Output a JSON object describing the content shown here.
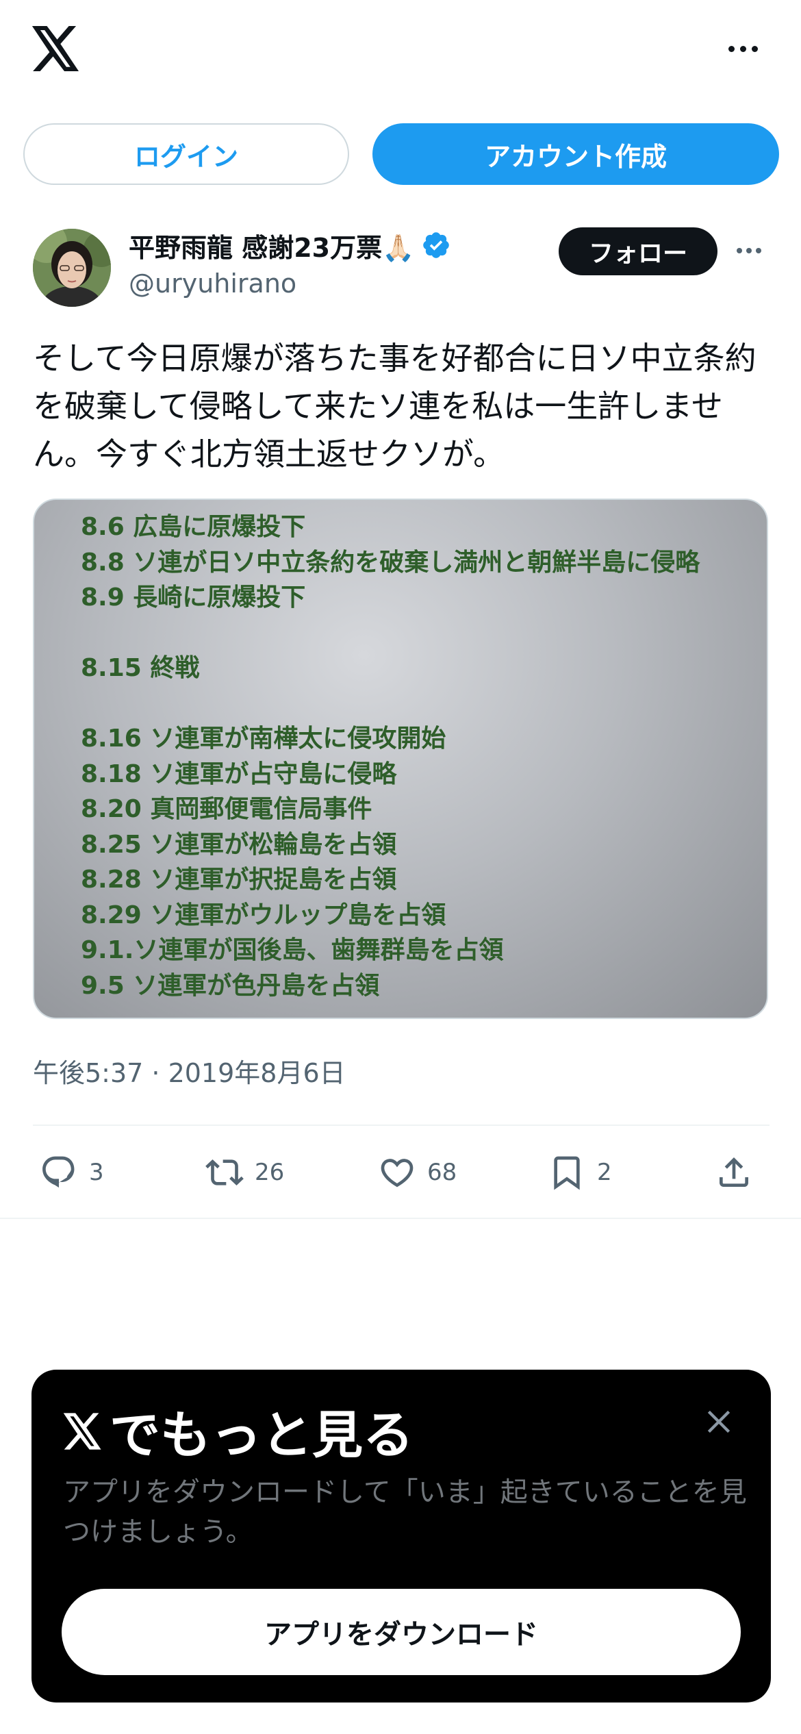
{
  "header": {
    "logo_icon": "x-logo-icon",
    "more_icon": "more-horizontal-icon"
  },
  "auth": {
    "login_label": "ログイン",
    "signup_label": "アカウント作成"
  },
  "post": {
    "author": {
      "display_name": "平野雨龍 感謝23万票🙏🏻",
      "handle": "@uryuhirano",
      "verified": true
    },
    "follow_label": "フォロー",
    "text": "そして今日原爆が落ちた事を好都合に日ソ中立条約を破棄して侵略して来たソ連を私は一生許しません。今すぐ北方領土返せクソが。",
    "image_lines": [
      "8.6 広島に原爆投下",
      "8.8 ソ連が日ソ中立条約を破棄し満州と朝鮮半島に侵略",
      "8.9 長崎に原爆投下",
      "",
      "8.15 終戦",
      "",
      "8.16 ソ連軍が南樺太に侵攻開始",
      "8.18 ソ連軍が占守島に侵略",
      "8.20 真岡郵便電信局事件",
      "8.25 ソ連軍が松輪島を占領",
      "8.28 ソ連軍が択捉島を占領",
      "8.29 ソ連軍がウルップ島を占領",
      "9.1.ソ連軍が国後島、歯舞群島を占領",
      "9.5 ソ連軍が色丹島を占領"
    ],
    "timestamp": "午後5:37 · 2019年8月6日",
    "stats": {
      "replies": "3",
      "reposts": "26",
      "likes": "68",
      "bookmarks": "2"
    }
  },
  "promo": {
    "title": "でもっと見る",
    "description": "アプリをダウンロードして「いま」起きていることを見つけましょう。",
    "download_label": "アプリをダウンロード"
  },
  "colors": {
    "accent": "#1d9bf0",
    "text_primary": "#0f1419",
    "text_secondary": "#536471",
    "image_text": "#2e5e2a"
  }
}
